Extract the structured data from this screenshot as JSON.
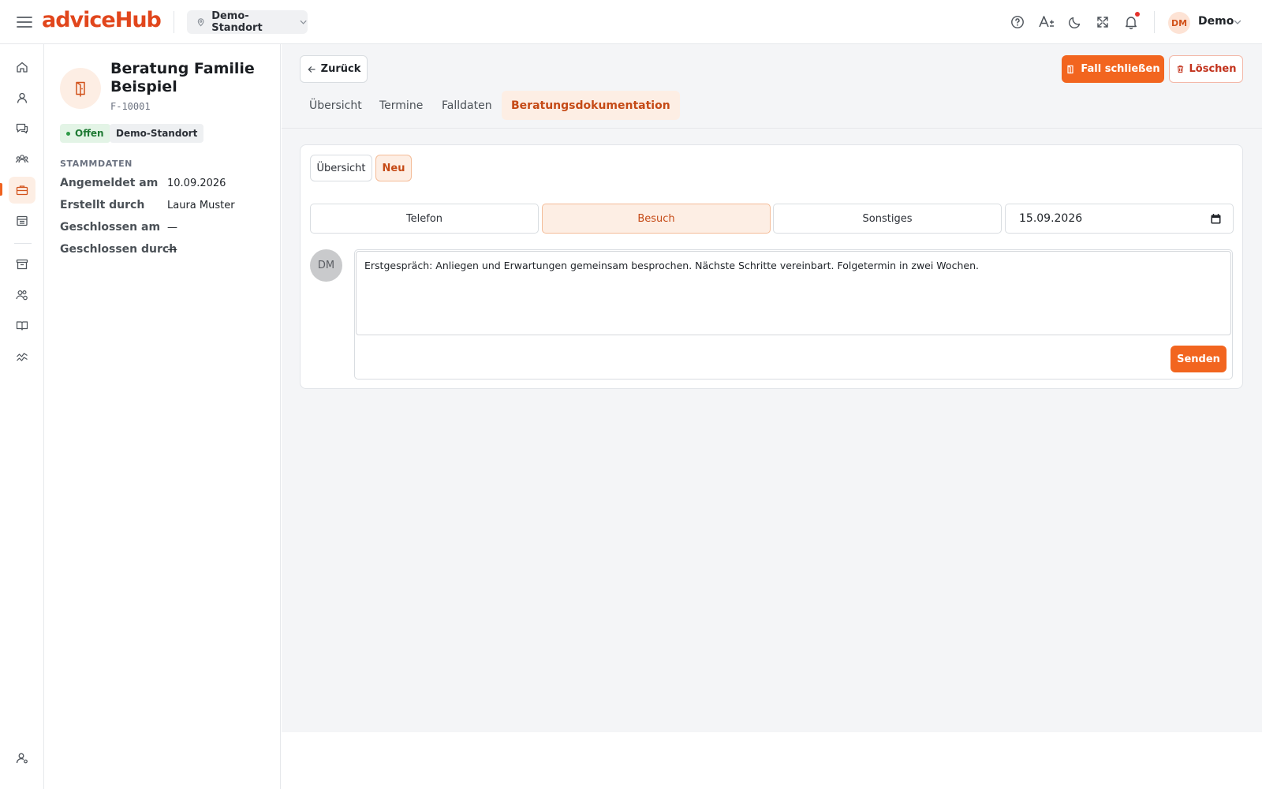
{
  "app": {
    "logo": "adviceHub",
    "location_selector": "Demo-Standort",
    "user": {
      "initials": "DM",
      "name": "Demo"
    },
    "accent_color": "#f2651f"
  },
  "topbar_icons": [
    "help-icon",
    "font-size-icon",
    "dark-mode-icon",
    "fullscreen-icon",
    "bell-icon"
  ],
  "rail": {
    "items": [
      "home-icon",
      "person-icon",
      "chat-icon",
      "group-icon",
      "briefcase-icon",
      "calendar-icon",
      "archive-icon",
      "users-settings-icon",
      "book-icon",
      "analytics-icon",
      "user-settings-icon"
    ],
    "active": "briefcase-icon"
  },
  "case": {
    "title": "Beratung Familie Beispiel",
    "id": "F-10001",
    "status": "Offen",
    "location": "Demo-Standort",
    "section_label": "STAMMDATEN",
    "fields": [
      {
        "key": "Angemeldet am",
        "value": "10.09.2026"
      },
      {
        "key": "Erstellt durch",
        "value": "Laura Muster"
      },
      {
        "key": "Geschlossen am",
        "value": "—"
      },
      {
        "key": "Geschlossen durch",
        "value": "—"
      }
    ]
  },
  "actions": {
    "back": "Zurück",
    "close_case": "Fall schließen",
    "delete": "Löschen"
  },
  "tabs": [
    "Übersicht",
    "Termine",
    "Falldaten",
    "Beratungsdokumentation"
  ],
  "active_tab": "Beratungsdokumentation",
  "documentation": {
    "subtabs": [
      "Übersicht",
      "Neu"
    ],
    "active_subtab": "Neu",
    "contact_types": [
      "Telefon",
      "Besuch",
      "Sonstiges"
    ],
    "selected_contact_type": "Besuch",
    "date": "15.09.2026",
    "author_initials": "DM",
    "note_text": "Erstgespräch: Anliegen und Erwartungen gemeinsam besprochen. Nächste Schritte vereinbart. Folgetermin in zwei Wochen.",
    "send": "Senden"
  }
}
